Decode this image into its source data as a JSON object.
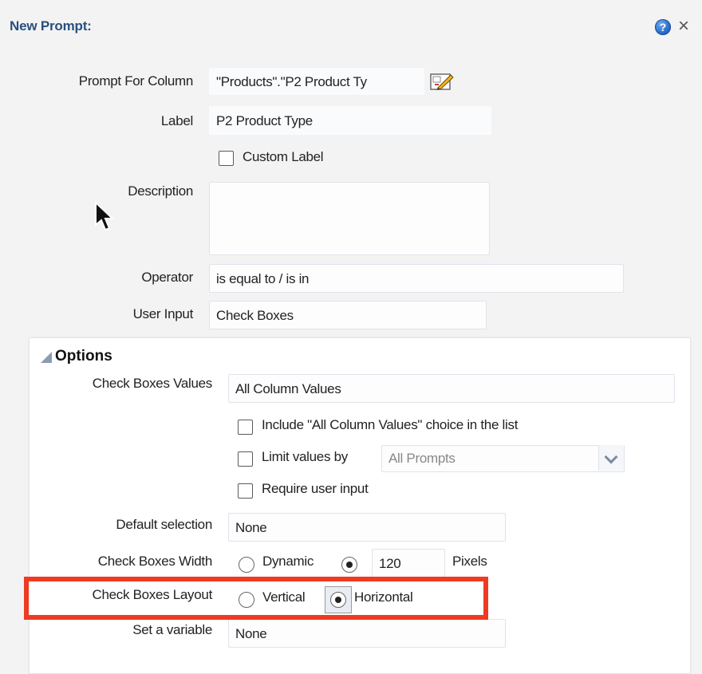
{
  "dialog": {
    "title": "New Prompt:",
    "help_icon": "?",
    "close_icon": "×"
  },
  "form": {
    "prompt_for_column": {
      "label": "Prompt For Column",
      "value": "\"Products\".\"P2  Product Ty"
    },
    "label_field": {
      "label": "Label",
      "value": "P2  Product Type"
    },
    "custom_label": {
      "label": "Custom Label",
      "checked": false
    },
    "description": {
      "label": "Description",
      "value": ""
    },
    "operator": {
      "label": "Operator",
      "value": "is equal to / is in"
    },
    "user_input": {
      "label": "User Input",
      "value": "Check Boxes"
    }
  },
  "options": {
    "title": "Options",
    "check_boxes_values": {
      "label": "Check Boxes Values",
      "value": "All Column Values"
    },
    "include_all": {
      "label": "Include \"All Column Values\" choice in the list",
      "checked": false
    },
    "limit_values": {
      "label": "Limit values by",
      "checked": false,
      "select_value": "All Prompts"
    },
    "require_input": {
      "label": "Require user input",
      "checked": false
    },
    "default_selection": {
      "label": "Default selection",
      "value": "None"
    },
    "check_boxes_width": {
      "label": "Check Boxes Width",
      "dynamic_label": "Dynamic",
      "value": "120",
      "unit": "Pixels",
      "selected": "fixed"
    },
    "check_boxes_layout": {
      "label": "Check Boxes Layout",
      "vertical_label": "Vertical",
      "horizontal_label": "Horizontal",
      "selected": "Horizontal"
    },
    "set_variable": {
      "label": "Set a variable",
      "value": "None"
    }
  },
  "colors": {
    "title": "#28507f",
    "highlight": "#ee3b23"
  }
}
